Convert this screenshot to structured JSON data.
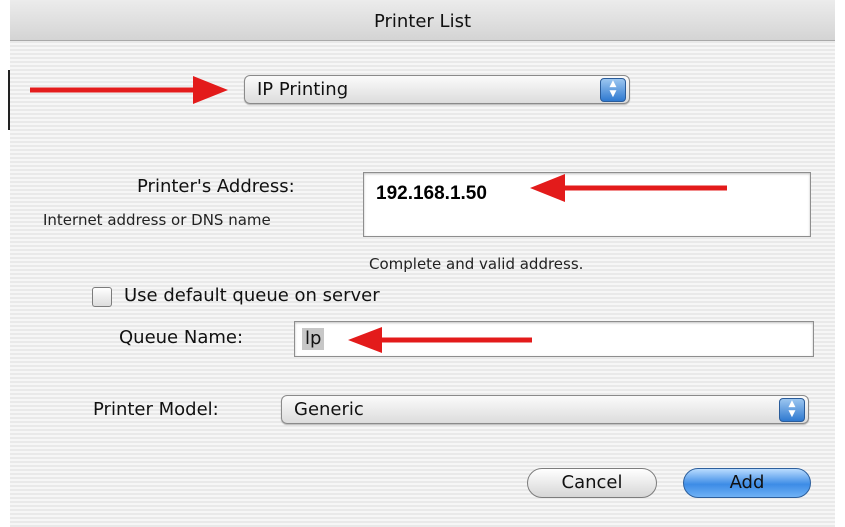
{
  "window": {
    "title": "Printer List"
  },
  "connection_popup": {
    "value": "IP Printing"
  },
  "address": {
    "label": "Printer's Address:",
    "hint": "Internet address or DNS name",
    "value": "192.168.1.50",
    "status": "Complete and valid address."
  },
  "default_queue": {
    "label": "Use default queue on server",
    "checked": false
  },
  "queue": {
    "label": "Queue Name:",
    "value": "lp"
  },
  "model": {
    "label": "Printer Model:",
    "value": "Generic"
  },
  "buttons": {
    "cancel": "Cancel",
    "add": "Add"
  },
  "annotation": {
    "arrow_color": "#e31b1b"
  },
  "icons": {
    "popup_stepper": "up-down-arrows-icon",
    "annotation_arrow": "red-arrow-icon",
    "checkbox": "checkbox-icon"
  }
}
